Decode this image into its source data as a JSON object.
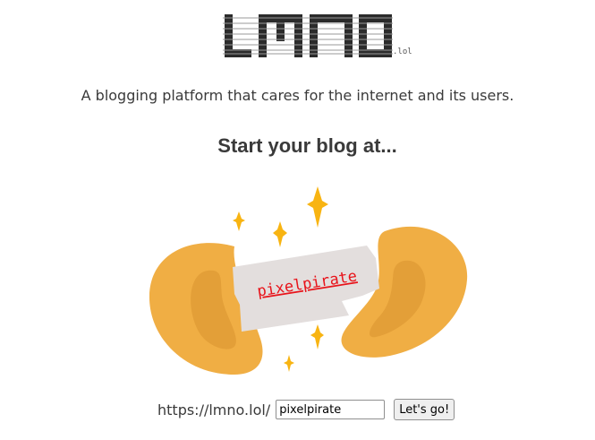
{
  "header": {
    "logo_text": "LMNO",
    "logo_tld": ".lol"
  },
  "tagline": "A blogging platform that cares for the internet and its users.",
  "heading": "Start your blog at...",
  "illustration": {
    "fortune_text": "pixelpirate",
    "colors": {
      "cookie": "#f0ae44",
      "cookie_shadow": "#e39f38",
      "paper": "#e3dedd",
      "sparkle": "#f8b412",
      "fortune_text": "#e8141b"
    }
  },
  "signup": {
    "url_prefix": "https://lmno.lol/",
    "input_value": "pixelpirate",
    "button_label": "Let's go!"
  }
}
